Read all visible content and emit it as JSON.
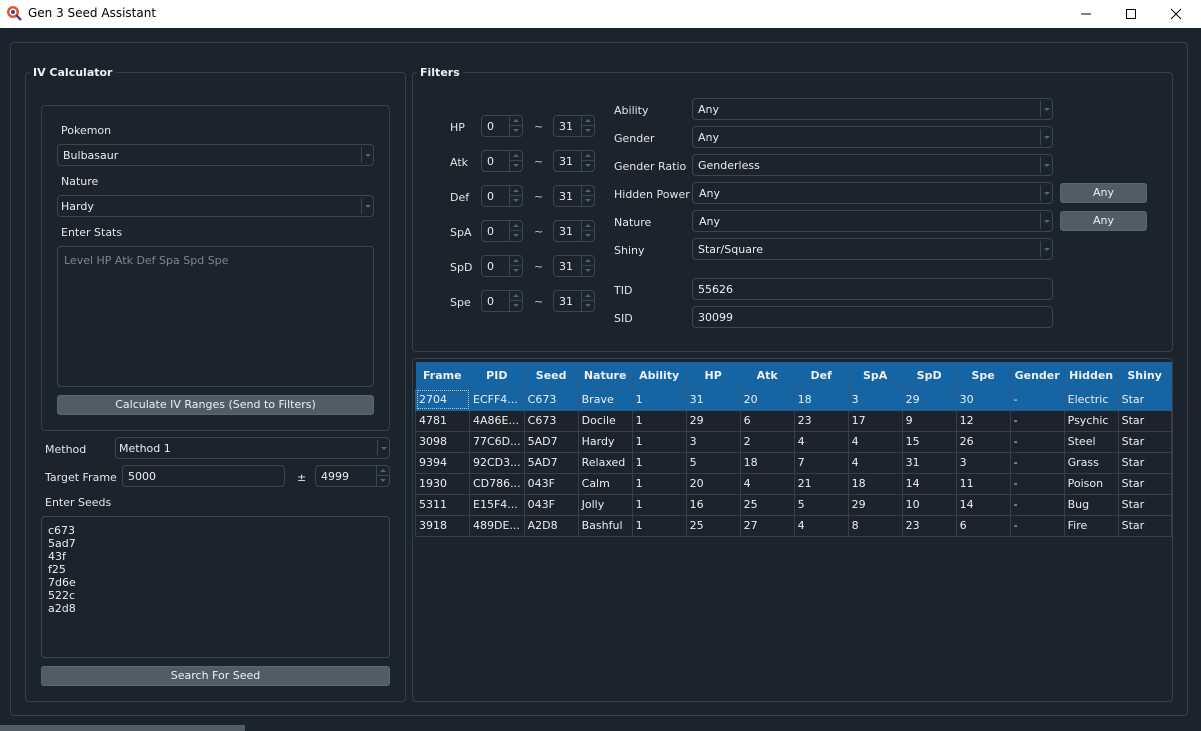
{
  "window": {
    "title": "Gen 3 Seed Assistant",
    "controls": {
      "minimize": "—",
      "maximize": "☐",
      "close": "✕"
    }
  },
  "iv_calculator": {
    "title": "IV Calculator",
    "pokemon_label": "Pokemon",
    "pokemon_value": "Bulbasaur",
    "nature_label": "Nature",
    "nature_value": "Hardy",
    "stats_label": "Enter Stats",
    "stats_placeholder": "Level HP Atk Def Spa Spd Spe",
    "calculate_button": "Calculate IV Ranges (Send to Filters)",
    "method_label": "Method",
    "method_value": "Method 1",
    "target_frame_label": "Target Frame",
    "target_frame_value": "5000",
    "plus_minus": "±",
    "frame_range_value": "4999",
    "seeds_label": "Enter Seeds",
    "seeds": [
      "c673",
      "5ad7",
      "43f",
      "f25",
      "7d6e",
      "522c",
      "a2d8"
    ],
    "search_button": "Search For Seed"
  },
  "filters": {
    "title": "Filters",
    "tilde": "~",
    "iv_rows": [
      {
        "label": "HP",
        "min": "0",
        "max": "31"
      },
      {
        "label": "Atk",
        "min": "0",
        "max": "31"
      },
      {
        "label": "Def",
        "min": "0",
        "max": "31"
      },
      {
        "label": "SpA",
        "min": "0",
        "max": "31"
      },
      {
        "label": "SpD",
        "min": "0",
        "max": "31"
      },
      {
        "label": "Spe",
        "min": "0",
        "max": "31"
      }
    ],
    "ability": {
      "label": "Ability",
      "value": "Any"
    },
    "gender": {
      "label": "Gender",
      "value": "Any"
    },
    "gender_ratio": {
      "label": "Gender Ratio",
      "value": "Genderless"
    },
    "hidden_power": {
      "label": "Hidden Power",
      "value": "Any",
      "button": "Any"
    },
    "nature": {
      "label": "Nature",
      "value": "Any",
      "button": "Any"
    },
    "shiny": {
      "label": "Shiny",
      "value": "Star/Square"
    },
    "tid": {
      "label": "TID",
      "value": "55626"
    },
    "sid": {
      "label": "SID",
      "value": "30099"
    }
  },
  "results": {
    "columns": [
      "Frame",
      "PID",
      "Seed",
      "Nature",
      "Ability",
      "HP",
      "Atk",
      "Def",
      "SpA",
      "SpD",
      "Spe",
      "Gender",
      "Hidden",
      "Shiny"
    ],
    "rows": [
      [
        "2704",
        "ECFF4...",
        "C673",
        "Brave",
        "1",
        "31",
        "20",
        "18",
        "3",
        "29",
        "30",
        "-",
        "Electric",
        "Star"
      ],
      [
        "4781",
        "4A86E...",
        "C673",
        "Docile",
        "1",
        "29",
        "6",
        "23",
        "17",
        "9",
        "12",
        "-",
        "Psychic",
        "Star"
      ],
      [
        "3098",
        "77C6D...",
        "5AD7",
        "Hardy",
        "1",
        "3",
        "2",
        "4",
        "4",
        "15",
        "26",
        "-",
        "Steel",
        "Star"
      ],
      [
        "9394",
        "92CD3...",
        "5AD7",
        "Relaxed",
        "1",
        "5",
        "18",
        "7",
        "4",
        "31",
        "3",
        "-",
        "Grass",
        "Star"
      ],
      [
        "1930",
        "CD786...",
        "043F",
        "Calm",
        "1",
        "20",
        "4",
        "21",
        "18",
        "14",
        "11",
        "-",
        "Poison",
        "Star"
      ],
      [
        "5311",
        "E15F4...",
        "043F",
        "Jolly",
        "1",
        "16",
        "25",
        "5",
        "29",
        "10",
        "14",
        "-",
        "Bug",
        "Star"
      ],
      [
        "3918",
        "489DE...",
        "A2D8",
        "Bashful",
        "1",
        "25",
        "27",
        "4",
        "8",
        "23",
        "6",
        "-",
        "Fire",
        "Star"
      ]
    ],
    "selected_row": 0
  },
  "colors": {
    "background": "#1b232d",
    "accent": "#1565a5",
    "button": "#505c66",
    "border": "#344049"
  }
}
